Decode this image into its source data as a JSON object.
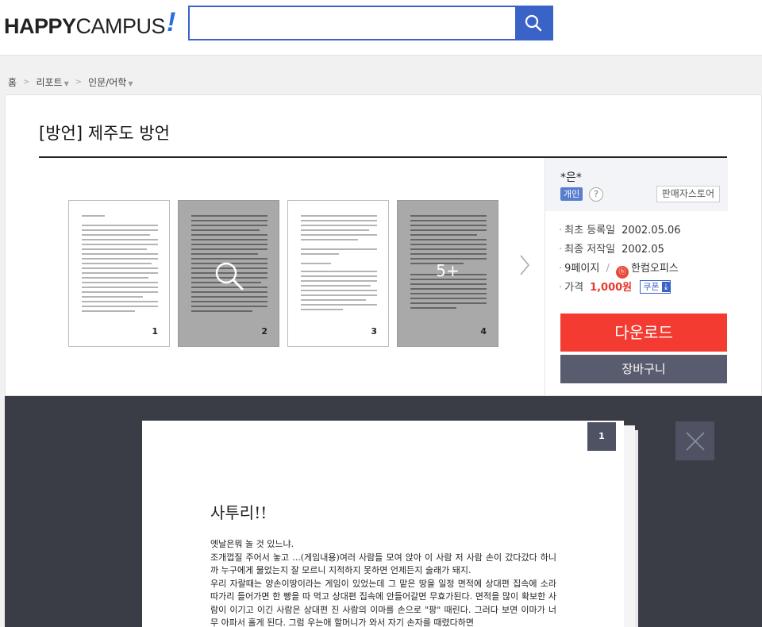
{
  "header": {
    "logo_bold": "HAPPY",
    "logo_thin": "CAMPUS",
    "logo_mark": "!",
    "search_placeholder": "",
    "search_icon": "search-icon"
  },
  "breadcrumb": {
    "home": "홈",
    "sep": ">",
    "items": [
      "리포트",
      "인문/어학"
    ]
  },
  "document": {
    "title": "[방언] 제주도 방언",
    "thumbnails": [
      {
        "num": "1",
        "style": "light"
      },
      {
        "num": "2",
        "style": "dark",
        "icon": "magnifier-icon"
      },
      {
        "num": "3",
        "style": "light"
      },
      {
        "num": "4",
        "style": "dark",
        "more": "5+"
      }
    ],
    "next_icon": "chevron-right-icon"
  },
  "seller": {
    "name": "*은*",
    "badge": "개인",
    "help": "?",
    "store_button": "판매자스토어"
  },
  "meta": {
    "registered_label": "최초 등록일",
    "registered_value": "2002.05.06",
    "written_label": "최종 저작일",
    "written_value": "2002.05",
    "pages": "9페이지",
    "slash": "/",
    "format_icon": "hancom-office-icon",
    "format_mark": "ⓗ",
    "format": "한컴오피스",
    "price_label": "가격",
    "price": "1,000원",
    "coupon": "쿠폰",
    "coupon_icon": "download-arrow-icon"
  },
  "actions": {
    "download": "다운로드",
    "cart": "장바구니"
  },
  "viewer": {
    "page_number": "1",
    "page_title": "사투리!!",
    "paragraphs": [
      "엣날은뭐 놀 것 있느냐.",
      "조개껍질 주어서 놓고 ...(게임내용)여러 사람들 모여 앉아 이 사람 저 사람 손이 갔다갔다 하니까 누구에게 물었는지 잘 모르니 지적하지 못하면 언제든지 술래가 돼지.",
      "우리 자랄때는 양손이땅이라는 게임이 있었는데 그 맡은 땅을 일정 면적에 상대편 집속에 소라 따가리 들어가면 한 빵을 따 먹고 상대편 집속에 안들어갈면 무효가된다. 면적을 많이 확보한 사람이 이기고 이긴 사람은 상대편 진 사람의 이마를 손으로 \"팡\" 때린다. 그러다 보면 이마가 너무 아파서 홀게 된다. 그럼 우는애 할머니가 와서 자기 손자를 때렸다하면"
    ],
    "close_icon": "close-icon"
  }
}
